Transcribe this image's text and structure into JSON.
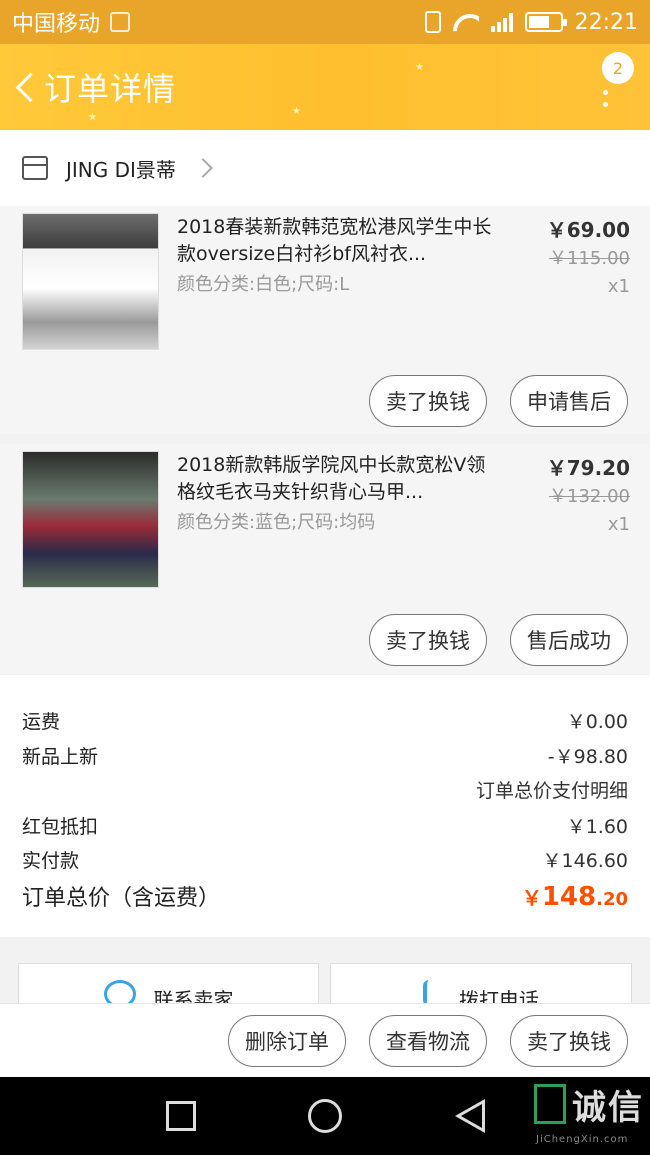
{
  "status_bar": {
    "carrier": "中国移动",
    "time": "22:21"
  },
  "header": {
    "title": "订单详情",
    "badge": "2"
  },
  "shop": {
    "name": "JING DI景蒂"
  },
  "items": [
    {
      "title": "2018春装新款韩范宽松港风学生中长款oversize白衬衫bf风衬衣...",
      "sku": "颜色分类:白色;尺码:L",
      "price": "￥69.00",
      "orig_price": "￥115.00",
      "qty": "x1",
      "buttons": [
        "卖了换钱",
        "申请售后"
      ]
    },
    {
      "title": "2018新款韩版学院风中长款宽松V领格纹毛衣马夹针织背心马甲...",
      "sku": "颜色分类:蓝色;尺码:均码",
      "price": "￥79.20",
      "orig_price": "￥132.00",
      "qty": "x1",
      "buttons": [
        "卖了换钱",
        "售后成功"
      ]
    }
  ],
  "summary": {
    "shipping_label": "运费",
    "shipping_value": "￥0.00",
    "promo_label": "新品上新",
    "promo_value": "-￥98.80",
    "detail_link": "订单总价支付明细",
    "redpack_label": "红包抵扣",
    "redpack_value": "￥1.60",
    "paid_label": "实付款",
    "paid_value": "￥146.60",
    "total_label": "订单总价（含运费）",
    "total_currency": "￥",
    "total_int": "148",
    "total_dec": ".20"
  },
  "contact": {
    "seller": "联系卖家",
    "call": "拨打电话"
  },
  "actions": {
    "delete": "删除订单",
    "logistics": "查看物流",
    "resell": "卖了换钱"
  },
  "watermark": {
    "text": "诚信",
    "sub": "JiChengXin.com"
  }
}
